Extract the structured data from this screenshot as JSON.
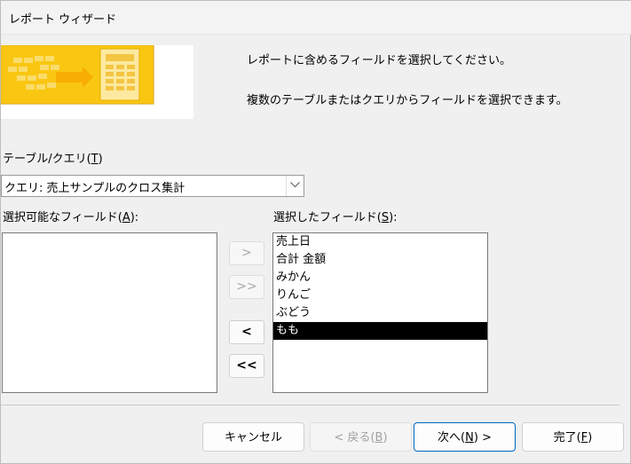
{
  "window": {
    "title": "レポート ウィザード"
  },
  "description": {
    "line1": "レポートに含めるフィールドを選択してください。",
    "line2": "複数のテーブルまたはクエリからフィールドを選択できます。"
  },
  "table_query": {
    "label_prefix": "テーブル/クエリ(",
    "label_key": "T",
    "label_suffix": ")",
    "selected_value": "クエリ: 売上サンプルのクロス集計"
  },
  "available_fields": {
    "label_prefix": "選択可能なフィールド(",
    "label_key": "A",
    "label_suffix": "):",
    "items": []
  },
  "selected_fields": {
    "label_prefix": "選択したフィールド(",
    "label_key": "S",
    "label_suffix": "):",
    "items": [
      "売上日",
      "合計 金額",
      "みかん",
      "りんご",
      "ぶどう",
      "もも"
    ],
    "highlighted": "もも"
  },
  "move_buttons": {
    "add_one": ">",
    "add_all": ">>",
    "remove_one": "<",
    "remove_all": "<<"
  },
  "footer": {
    "cancel": "キャンセル",
    "back_prefix": "< 戻る(",
    "back_key": "B",
    "back_suffix": ")",
    "next_prefix": "次へ(",
    "next_key": "N",
    "next_suffix": ") >",
    "finish_prefix": "完了(",
    "finish_key": "F",
    "finish_suffix": ")"
  },
  "colors": {
    "selection_bg": "#000000",
    "accent_border": "#0067c0",
    "banner_yellow": "#f5c518"
  }
}
